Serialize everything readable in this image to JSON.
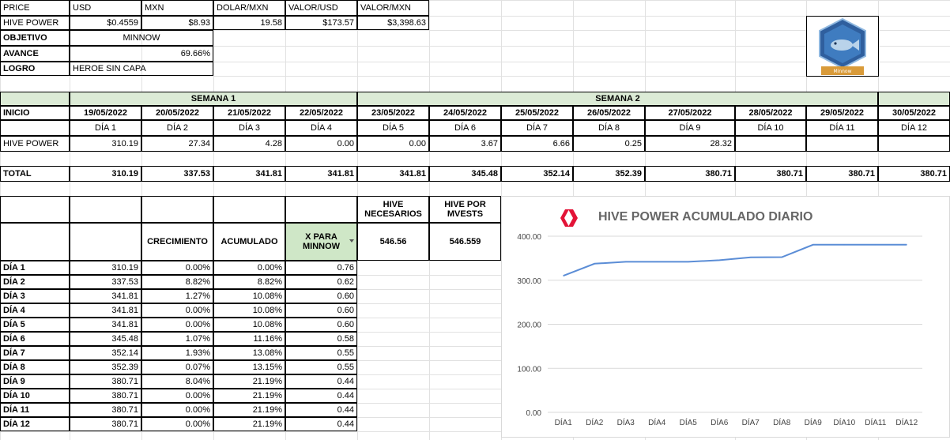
{
  "header_row": [
    "PRICE",
    "USD",
    "MXN",
    "DOLAR/MXN",
    "VALOR/USD",
    "VALOR/MXN"
  ],
  "hive_row": [
    "HIVE POWER",
    "$0.4559",
    "$8.93",
    "19.58",
    "$173.57",
    "$3,398.63"
  ],
  "info": [
    {
      "label": "OBJETIVO",
      "value": "MINNOW"
    },
    {
      "label": "AVANCE",
      "value": "69.66%"
    },
    {
      "label": "LOGRO",
      "value": "HEROE SIN CAPA"
    }
  ],
  "logo_caption": "Minnow",
  "colors": {
    "green": "#dcebd6",
    "line": "#5b8dd6",
    "hive_red": "#e31337"
  },
  "week1": "SEMANA 1",
  "week2": "SEMANA 2",
  "inicio": "INICIO",
  "dates": [
    "19/05/2022",
    "20/05/2022",
    "21/05/2022",
    "22/05/2022",
    "23/05/2022",
    "24/05/2022",
    "25/05/2022",
    "26/05/2022",
    "27/05/2022",
    "28/05/2022",
    "29/05/2022",
    "30/05/2022"
  ],
  "dias": [
    "DÍA 1",
    "DÍA 2",
    "DÍA 3",
    "DÍA 4",
    "DÍA 5",
    "DÍA 6",
    "DÍA 7",
    "DÍA 8",
    "DÍA 9",
    "DÍA 10",
    "DÍA 11",
    "DÍA 12"
  ],
  "hp_label": "HIVE POWER",
  "hp_values": [
    "310.19",
    "27.34",
    "4.28",
    "0.00",
    "0.00",
    "3.67",
    "6.66",
    "0.25",
    "28.32",
    "",
    "",
    ""
  ],
  "total_label": "TOTAL",
  "totals": [
    "310.19",
    "337.53",
    "341.81",
    "341.81",
    "341.81",
    "345.48",
    "352.14",
    "352.39",
    "380.71",
    "380.71",
    "380.71",
    "380.71"
  ],
  "needed": {
    "h1": "HIVE NECESARIOS",
    "h2": "HIVE POR MVESTS",
    "v1": "546.56",
    "v2": "546.559"
  },
  "table_headers": {
    "crec": "CRECIMIENTO",
    "acum": "ACUMULADO",
    "xpara": "X PARA MINNOW"
  },
  "rows": [
    {
      "dia": "DÍA 1",
      "total": "310.19",
      "crec": "0.00%",
      "acum": "0.00%",
      "x": "0.76"
    },
    {
      "dia": "DÍA 2",
      "total": "337.53",
      "crec": "8.82%",
      "acum": "8.82%",
      "x": "0.62"
    },
    {
      "dia": "DÍA 3",
      "total": "341.81",
      "crec": "1.27%",
      "acum": "10.08%",
      "x": "0.60"
    },
    {
      "dia": "DÍA 4",
      "total": "341.81",
      "crec": "0.00%",
      "acum": "10.08%",
      "x": "0.60"
    },
    {
      "dia": "DÍA 5",
      "total": "341.81",
      "crec": "0.00%",
      "acum": "10.08%",
      "x": "0.60"
    },
    {
      "dia": "DÍA 6",
      "total": "345.48",
      "crec": "1.07%",
      "acum": "11.16%",
      "x": "0.58"
    },
    {
      "dia": "DÍA 7",
      "total": "352.14",
      "crec": "1.93%",
      "acum": "13.08%",
      "x": "0.55"
    },
    {
      "dia": "DÍA 8",
      "total": "352.39",
      "crec": "0.07%",
      "acum": "13.15%",
      "x": "0.55"
    },
    {
      "dia": "DÍA 9",
      "total": "380.71",
      "crec": "8.04%",
      "acum": "21.19%",
      "x": "0.44"
    },
    {
      "dia": "DÍA 10",
      "total": "380.71",
      "crec": "0.00%",
      "acum": "21.19%",
      "x": "0.44"
    },
    {
      "dia": "DÍA 11",
      "total": "380.71",
      "crec": "0.00%",
      "acum": "21.19%",
      "x": "0.44"
    },
    {
      "dia": "DÍA 12",
      "total": "380.71",
      "crec": "0.00%",
      "acum": "21.19%",
      "x": "0.44"
    }
  ],
  "chart_data": {
    "type": "line",
    "title": "HIVE POWER ACUMULADO DIARIO",
    "categories": [
      "DÍA1",
      "DÍA2",
      "DÍA3",
      "DÍA4",
      "DÍA5",
      "DÍA6",
      "DÍA7",
      "DÍA8",
      "DÍA9",
      "DÍA10",
      "DÍA11",
      "DÍA12"
    ],
    "values": [
      310.19,
      337.53,
      341.81,
      341.81,
      341.81,
      345.48,
      352.14,
      352.39,
      380.71,
      380.71,
      380.71,
      380.71
    ],
    "yticks": [
      "0.00",
      "100.00",
      "200.00",
      "300.00",
      "400.00"
    ],
    "ylim": [
      0,
      400
    ],
    "grid": true,
    "legend": "none"
  }
}
